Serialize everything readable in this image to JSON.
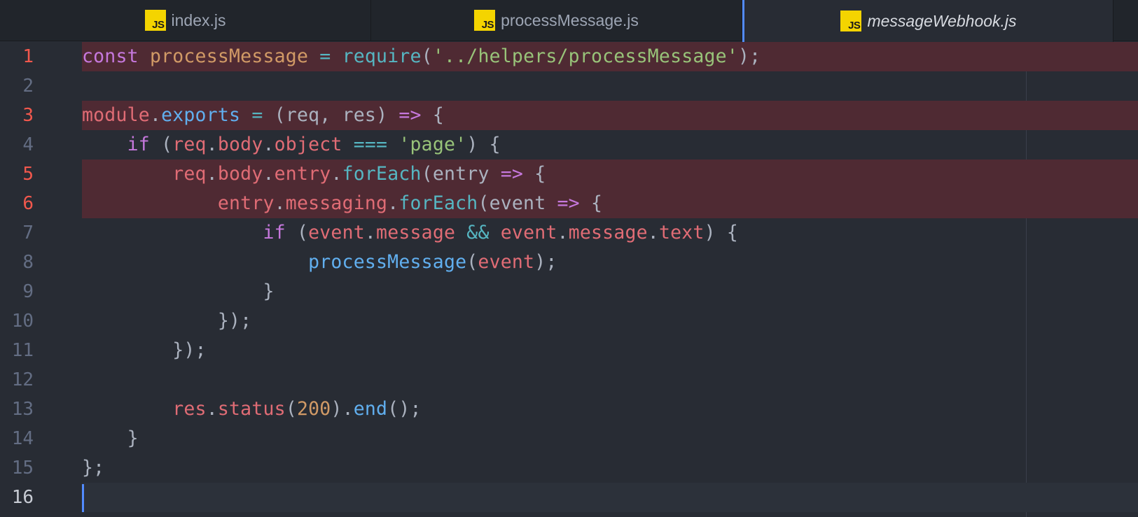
{
  "tabs": [
    {
      "icon": "js-file-icon",
      "badge": "JS",
      "label": "index.js",
      "active": false
    },
    {
      "icon": "js-file-icon",
      "badge": "JS",
      "label": "processMessage.js",
      "active": false
    },
    {
      "icon": "js-file-icon",
      "badge": "JS",
      "label": "messageWebhook.js",
      "active": true
    }
  ],
  "editor": {
    "cursor_line": 16,
    "lines": [
      {
        "no": "1",
        "state": "modified",
        "tokens": [
          {
            "t": "const",
            "c": "keyword"
          },
          {
            "t": " ",
            "c": "plain"
          },
          {
            "t": "processMessage",
            "c": "orange"
          },
          {
            "t": " ",
            "c": "plain"
          },
          {
            "t": "=",
            "c": "operator"
          },
          {
            "t": " ",
            "c": "plain"
          },
          {
            "t": "require",
            "c": "builtin"
          },
          {
            "t": "(",
            "c": "punct"
          },
          {
            "t": "'../helpers/processMessage'",
            "c": "string"
          },
          {
            "t": ");",
            "c": "punct"
          }
        ]
      },
      {
        "no": "2",
        "state": "normal",
        "tokens": []
      },
      {
        "no": "3",
        "state": "modified",
        "tokens": [
          {
            "t": "module",
            "c": "var"
          },
          {
            "t": ".",
            "c": "punct"
          },
          {
            "t": "exports",
            "c": "func"
          },
          {
            "t": " ",
            "c": "plain"
          },
          {
            "t": "=",
            "c": "operator"
          },
          {
            "t": " (",
            "c": "punct"
          },
          {
            "t": "req",
            "c": "plain"
          },
          {
            "t": ", ",
            "c": "punct"
          },
          {
            "t": "res",
            "c": "plain"
          },
          {
            "t": ") ",
            "c": "punct"
          },
          {
            "t": "=>",
            "c": "arrow"
          },
          {
            "t": " {",
            "c": "punct"
          }
        ]
      },
      {
        "no": "4",
        "state": "normal",
        "tokens": [
          {
            "t": "    ",
            "c": "plain"
          },
          {
            "t": "if",
            "c": "keyword"
          },
          {
            "t": " (",
            "c": "punct"
          },
          {
            "t": "req",
            "c": "var"
          },
          {
            "t": ".",
            "c": "punct"
          },
          {
            "t": "body",
            "c": "var"
          },
          {
            "t": ".",
            "c": "punct"
          },
          {
            "t": "object",
            "c": "var"
          },
          {
            "t": " ",
            "c": "plain"
          },
          {
            "t": "===",
            "c": "operator"
          },
          {
            "t": " ",
            "c": "plain"
          },
          {
            "t": "'page'",
            "c": "string"
          },
          {
            "t": ") {",
            "c": "punct"
          }
        ]
      },
      {
        "no": "5",
        "state": "modified",
        "tokens": [
          {
            "t": "        ",
            "c": "plain"
          },
          {
            "t": "req",
            "c": "var"
          },
          {
            "t": ".",
            "c": "punct"
          },
          {
            "t": "body",
            "c": "var"
          },
          {
            "t": ".",
            "c": "punct"
          },
          {
            "t": "entry",
            "c": "var"
          },
          {
            "t": ".",
            "c": "punct"
          },
          {
            "t": "forEach",
            "c": "builtin"
          },
          {
            "t": "(",
            "c": "punct"
          },
          {
            "t": "entry",
            "c": "plain"
          },
          {
            "t": " ",
            "c": "plain"
          },
          {
            "t": "=>",
            "c": "arrow"
          },
          {
            "t": " {",
            "c": "punct"
          }
        ]
      },
      {
        "no": "6",
        "state": "modified",
        "tokens": [
          {
            "t": "            ",
            "c": "plain"
          },
          {
            "t": "entry",
            "c": "var"
          },
          {
            "t": ".",
            "c": "punct"
          },
          {
            "t": "messaging",
            "c": "var"
          },
          {
            "t": ".",
            "c": "punct"
          },
          {
            "t": "forEach",
            "c": "builtin"
          },
          {
            "t": "(",
            "c": "punct"
          },
          {
            "t": "event",
            "c": "plain"
          },
          {
            "t": " ",
            "c": "plain"
          },
          {
            "t": "=>",
            "c": "arrow"
          },
          {
            "t": " {",
            "c": "punct"
          }
        ]
      },
      {
        "no": "7",
        "state": "normal",
        "tokens": [
          {
            "t": "                ",
            "c": "plain"
          },
          {
            "t": "if",
            "c": "keyword"
          },
          {
            "t": " (",
            "c": "punct"
          },
          {
            "t": "event",
            "c": "var"
          },
          {
            "t": ".",
            "c": "punct"
          },
          {
            "t": "message",
            "c": "var"
          },
          {
            "t": " ",
            "c": "plain"
          },
          {
            "t": "&&",
            "c": "operator"
          },
          {
            "t": " ",
            "c": "plain"
          },
          {
            "t": "event",
            "c": "var"
          },
          {
            "t": ".",
            "c": "punct"
          },
          {
            "t": "message",
            "c": "var"
          },
          {
            "t": ".",
            "c": "punct"
          },
          {
            "t": "text",
            "c": "var"
          },
          {
            "t": ") {",
            "c": "punct"
          }
        ]
      },
      {
        "no": "8",
        "state": "normal",
        "tokens": [
          {
            "t": "                    ",
            "c": "plain"
          },
          {
            "t": "processMessage",
            "c": "func"
          },
          {
            "t": "(",
            "c": "punct"
          },
          {
            "t": "event",
            "c": "var"
          },
          {
            "t": ");",
            "c": "punct"
          }
        ]
      },
      {
        "no": "9",
        "state": "normal",
        "tokens": [
          {
            "t": "                ",
            "c": "plain"
          },
          {
            "t": "}",
            "c": "punct"
          }
        ]
      },
      {
        "no": "10",
        "state": "normal",
        "tokens": [
          {
            "t": "            ",
            "c": "plain"
          },
          {
            "t": "});",
            "c": "punct"
          }
        ]
      },
      {
        "no": "11",
        "state": "normal",
        "tokens": [
          {
            "t": "        ",
            "c": "plain"
          },
          {
            "t": "});",
            "c": "punct"
          }
        ]
      },
      {
        "no": "12",
        "state": "normal",
        "tokens": []
      },
      {
        "no": "13",
        "state": "normal",
        "tokens": [
          {
            "t": "        ",
            "c": "plain"
          },
          {
            "t": "res",
            "c": "var"
          },
          {
            "t": ".",
            "c": "punct"
          },
          {
            "t": "status",
            "c": "var"
          },
          {
            "t": "(",
            "c": "punct"
          },
          {
            "t": "200",
            "c": "number"
          },
          {
            "t": ").",
            "c": "punct"
          },
          {
            "t": "end",
            "c": "func"
          },
          {
            "t": "();",
            "c": "punct"
          }
        ]
      },
      {
        "no": "14",
        "state": "normal",
        "tokens": [
          {
            "t": "    ",
            "c": "plain"
          },
          {
            "t": "}",
            "c": "punct"
          }
        ]
      },
      {
        "no": "15",
        "state": "normal",
        "tokens": [
          {
            "t": "};",
            "c": "punct"
          }
        ]
      },
      {
        "no": "16",
        "state": "cursor",
        "tokens": []
      }
    ]
  },
  "colors": {
    "background": "#282c34",
    "tabbar": "#21252b",
    "modified_line_bg": "#4f2a33",
    "modified_line_number": "#f2584d",
    "accent": "#528bff",
    "js_badge": "#f4d400"
  }
}
